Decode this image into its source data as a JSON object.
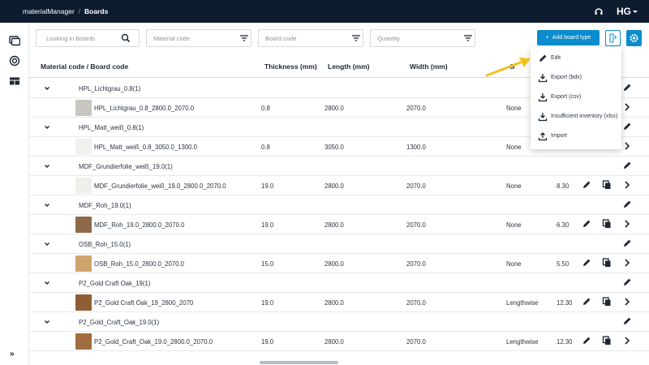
{
  "app": {
    "name": "materialManager",
    "section": "Boards"
  },
  "filters": {
    "search_placeholder": "Looking in Boards",
    "material_placeholder": "Material code",
    "board_placeholder": "Board code",
    "quantity_placeholder": "Quantity"
  },
  "toolbar": {
    "add_label": "Add board type"
  },
  "table": {
    "headers": [
      "Material code / Board code",
      "Thickness (mm)",
      "Length (mm)",
      "Width (mm)",
      "G"
    ],
    "groups": [
      {
        "name": "HPL_Lichtgrau_0.8(1)",
        "board": "HPL_Lichtgrau_0.8_2800.0_2070.0",
        "thickness": "0.8",
        "length": "2800.0",
        "width": "2070.0",
        "grain": "None",
        "qty": "",
        "thumb": "#c9c6c1"
      },
      {
        "name": "HPL_Matt_weiß_0.8(1)",
        "board": "HPL_Matt_weiß_0.8_3050.0_1300.0",
        "thickness": "0.8",
        "length": "3050.0",
        "width": "1300.0",
        "grain": "None",
        "qty": "",
        "thumb": "#f3f1ee"
      },
      {
        "name": "MDF_Grundierfolie_weiß_19.0(1)",
        "board": "MDF_Grundierfolie_weiß_19.0_2800.0_2070.0",
        "thickness": "19.0",
        "length": "2800.0",
        "width": "2070.0",
        "grain": "None",
        "qty": "8.30",
        "thumb": "#f1efec"
      },
      {
        "name": "MDF_Roh_19.0(1)",
        "board": "MDF_Roh_19.0_2800.0_2070.0",
        "thickness": "19.0",
        "length": "2800.0",
        "width": "2070.0",
        "grain": "None",
        "qty": "6.30",
        "thumb": "#8d6a4a"
      },
      {
        "name": "OSB_Roh_15.0(1)",
        "board": "OSB_Roh_15.0_2800.0_2070.0",
        "thickness": "15.0",
        "length": "2800.0",
        "width": "2070.0",
        "grain": "None",
        "qty": "5.50",
        "thumb": "#cfa56d"
      },
      {
        "name": "P2_Gold Craft Oak_19(1)",
        "board": "P2_Gold Craft Oak_19_2800_2070",
        "thickness": "19.0",
        "length": "2800.0",
        "width": "2070.0",
        "grain": "Lengthwise",
        "qty": "12.30",
        "thumb": "#8f5f33"
      },
      {
        "name": "P2_Gold_Craft_Oak_19.0(1)",
        "board": "P2_Gold_Craft_Oak_19.0_2800.0_2070.0",
        "thickness": "19.0",
        "length": "2800.0",
        "width": "2070.0",
        "grain": "Lengthwise",
        "qty": "12.30",
        "thumb": "#a06e3e"
      }
    ]
  },
  "menu": {
    "items": [
      {
        "label": "Edit",
        "icon": "pencil-icon"
      },
      {
        "label": "Export (bdx)",
        "icon": "download-icon"
      },
      {
        "label": "Export (csv)",
        "icon": "download-icon"
      },
      {
        "label": "Insufficient inventory (xlsx)",
        "icon": "download-icon"
      },
      {
        "label": "Import",
        "icon": "upload-icon"
      }
    ]
  },
  "colors": {
    "topbar": "#0d1b2e",
    "accent": "#0a8ccd",
    "arrow": "#f2c21b"
  }
}
